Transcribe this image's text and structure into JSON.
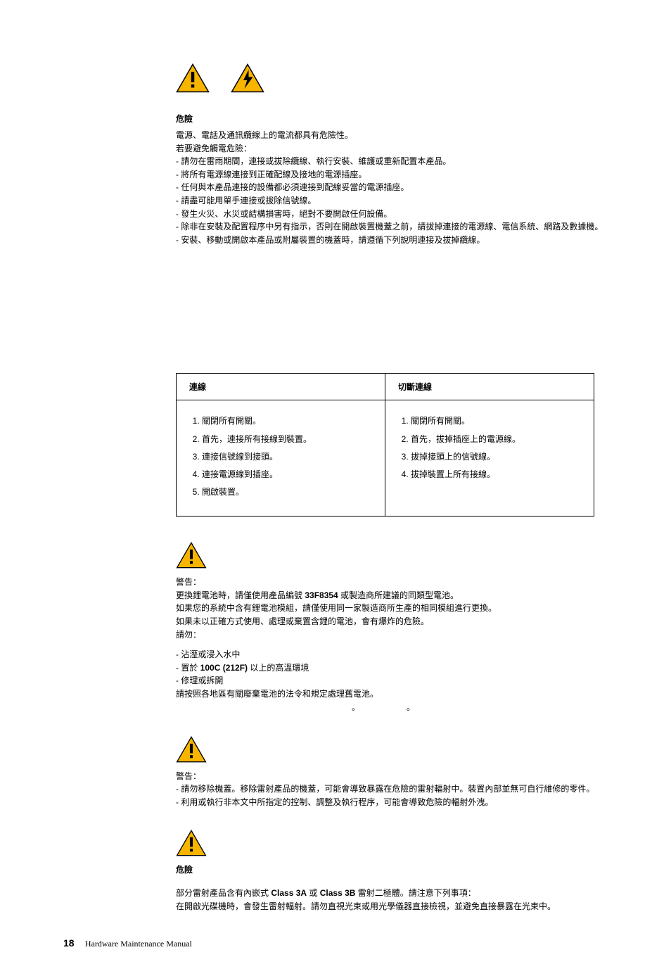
{
  "danger1": {
    "title": "危險",
    "lines": [
      "電源、電話及通訊纜線上的電流都具有危險性。",
      "若要避免觸電危險：",
      "- 請勿在雷雨期間，連接或拔除纜線、執行安裝、維護或重新配置本產品。",
      "- 將所有電源線連接到正確配線及接地的電源插座。",
      "- 任何與本產品連接的設備都必須連接到配線妥當的電源插座。",
      "- 請盡可能用單手連接或拔除信號線。",
      "- 發生火災、水災或結構損害時，絕對不要開啟任何設備。",
      "- 除非在安裝及配置程序中另有指示，否則在開啟裝置機蓋之前，請拔掉連接的電源線、電信系統、網路及數據機。",
      "- 安裝、移動或開啟本產品或附屬裝置的機蓋時，請遵循下列說明連接及拔掉纜線。"
    ]
  },
  "table": {
    "h1": "連線",
    "h2": "切斷連線",
    "left": [
      "關閉所有開關。",
      "首先，連接所有接線到裝置。",
      "連接信號線到接頭。",
      "連接電源線到插座。",
      "開啟裝置。"
    ],
    "right": [
      "關閉所有開關。",
      "首先，拔掉插座上的電源線。",
      "拔掉接頭上的信號線。",
      "拔掉裝置上所有接線。"
    ]
  },
  "caution1": {
    "title": "警告：",
    "l1_a": "更換鋰電池時，請僅使用產品編號 ",
    "l1_bold": "33F8354",
    "l1_b": " 或製造商所建議的同類型電池。",
    "l2": "如果您的系統中含有鋰電池模組，請僅使用同一家製造商所生產的相同模組進行更換。",
    "l3": "如果未以正確方式使用、處理或棄置含鋰的電池，會有爆炸的危險。",
    "l4": "請勿：",
    "b1": "- 沾溼或浸入水中",
    "b2_a": "- 置於 ",
    "b2_bold": "100C (212F)",
    "b2_b": " 以上的高溫環境",
    "b3": "- 修理或拆開",
    "l5": "請按照各地區有關廢棄電池的法令和規定處理舊電池。"
  },
  "caution2": {
    "title": "警告：",
    "l1": "- 請勿移除機蓋。移除雷射產品的機蓋，可能會導致暴露在危險的雷射輻射中。裝置內部並無可自行維修的零件。",
    "l2": "- 利用或執行非本文中所指定的控制、調整及執行程序，可能會導致危險的輻射外洩。"
  },
  "danger2": {
    "title": "危險",
    "l1_a": "部分雷射產品含有內嵌式 ",
    "l1_b1": "Class 3A",
    "l1_mid": " 或 ",
    "l1_b2": "Class 3B",
    "l1_b": " 雷射二極體。請注意下列事項：",
    "l2": "在開啟光碟機時，會發生雷射輻射。請勿直視光束或用光學儀器直接檢視，並避免直接暴露在光束中。"
  },
  "footer": {
    "page": "18",
    "title": "Hardware Maintenance Manual"
  }
}
